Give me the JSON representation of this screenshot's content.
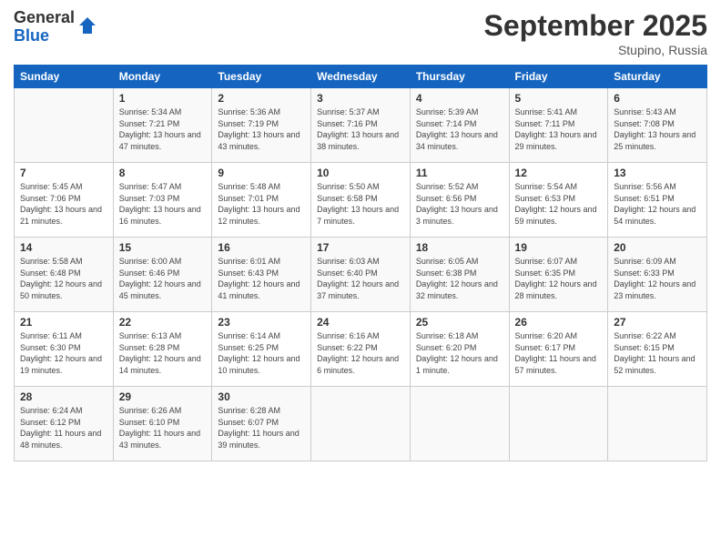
{
  "header": {
    "logo_general": "General",
    "logo_blue": "Blue",
    "month_title": "September 2025",
    "location": "Stupino, Russia"
  },
  "days_of_week": [
    "Sunday",
    "Monday",
    "Tuesday",
    "Wednesday",
    "Thursday",
    "Friday",
    "Saturday"
  ],
  "weeks": [
    [
      {
        "day": "",
        "sunrise": "",
        "sunset": "",
        "daylight": ""
      },
      {
        "day": "1",
        "sunrise": "Sunrise: 5:34 AM",
        "sunset": "Sunset: 7:21 PM",
        "daylight": "Daylight: 13 hours and 47 minutes."
      },
      {
        "day": "2",
        "sunrise": "Sunrise: 5:36 AM",
        "sunset": "Sunset: 7:19 PM",
        "daylight": "Daylight: 13 hours and 43 minutes."
      },
      {
        "day": "3",
        "sunrise": "Sunrise: 5:37 AM",
        "sunset": "Sunset: 7:16 PM",
        "daylight": "Daylight: 13 hours and 38 minutes."
      },
      {
        "day": "4",
        "sunrise": "Sunrise: 5:39 AM",
        "sunset": "Sunset: 7:14 PM",
        "daylight": "Daylight: 13 hours and 34 minutes."
      },
      {
        "day": "5",
        "sunrise": "Sunrise: 5:41 AM",
        "sunset": "Sunset: 7:11 PM",
        "daylight": "Daylight: 13 hours and 29 minutes."
      },
      {
        "day": "6",
        "sunrise": "Sunrise: 5:43 AM",
        "sunset": "Sunset: 7:08 PM",
        "daylight": "Daylight: 13 hours and 25 minutes."
      }
    ],
    [
      {
        "day": "7",
        "sunrise": "Sunrise: 5:45 AM",
        "sunset": "Sunset: 7:06 PM",
        "daylight": "Daylight: 13 hours and 21 minutes."
      },
      {
        "day": "8",
        "sunrise": "Sunrise: 5:47 AM",
        "sunset": "Sunset: 7:03 PM",
        "daylight": "Daylight: 13 hours and 16 minutes."
      },
      {
        "day": "9",
        "sunrise": "Sunrise: 5:48 AM",
        "sunset": "Sunset: 7:01 PM",
        "daylight": "Daylight: 13 hours and 12 minutes."
      },
      {
        "day": "10",
        "sunrise": "Sunrise: 5:50 AM",
        "sunset": "Sunset: 6:58 PM",
        "daylight": "Daylight: 13 hours and 7 minutes."
      },
      {
        "day": "11",
        "sunrise": "Sunrise: 5:52 AM",
        "sunset": "Sunset: 6:56 PM",
        "daylight": "Daylight: 13 hours and 3 minutes."
      },
      {
        "day": "12",
        "sunrise": "Sunrise: 5:54 AM",
        "sunset": "Sunset: 6:53 PM",
        "daylight": "Daylight: 12 hours and 59 minutes."
      },
      {
        "day": "13",
        "sunrise": "Sunrise: 5:56 AM",
        "sunset": "Sunset: 6:51 PM",
        "daylight": "Daylight: 12 hours and 54 minutes."
      }
    ],
    [
      {
        "day": "14",
        "sunrise": "Sunrise: 5:58 AM",
        "sunset": "Sunset: 6:48 PM",
        "daylight": "Daylight: 12 hours and 50 minutes."
      },
      {
        "day": "15",
        "sunrise": "Sunrise: 6:00 AM",
        "sunset": "Sunset: 6:46 PM",
        "daylight": "Daylight: 12 hours and 45 minutes."
      },
      {
        "day": "16",
        "sunrise": "Sunrise: 6:01 AM",
        "sunset": "Sunset: 6:43 PM",
        "daylight": "Daylight: 12 hours and 41 minutes."
      },
      {
        "day": "17",
        "sunrise": "Sunrise: 6:03 AM",
        "sunset": "Sunset: 6:40 PM",
        "daylight": "Daylight: 12 hours and 37 minutes."
      },
      {
        "day": "18",
        "sunrise": "Sunrise: 6:05 AM",
        "sunset": "Sunset: 6:38 PM",
        "daylight": "Daylight: 12 hours and 32 minutes."
      },
      {
        "day": "19",
        "sunrise": "Sunrise: 6:07 AM",
        "sunset": "Sunset: 6:35 PM",
        "daylight": "Daylight: 12 hours and 28 minutes."
      },
      {
        "day": "20",
        "sunrise": "Sunrise: 6:09 AM",
        "sunset": "Sunset: 6:33 PM",
        "daylight": "Daylight: 12 hours and 23 minutes."
      }
    ],
    [
      {
        "day": "21",
        "sunrise": "Sunrise: 6:11 AM",
        "sunset": "Sunset: 6:30 PM",
        "daylight": "Daylight: 12 hours and 19 minutes."
      },
      {
        "day": "22",
        "sunrise": "Sunrise: 6:13 AM",
        "sunset": "Sunset: 6:28 PM",
        "daylight": "Daylight: 12 hours and 14 minutes."
      },
      {
        "day": "23",
        "sunrise": "Sunrise: 6:14 AM",
        "sunset": "Sunset: 6:25 PM",
        "daylight": "Daylight: 12 hours and 10 minutes."
      },
      {
        "day": "24",
        "sunrise": "Sunrise: 6:16 AM",
        "sunset": "Sunset: 6:22 PM",
        "daylight": "Daylight: 12 hours and 6 minutes."
      },
      {
        "day": "25",
        "sunrise": "Sunrise: 6:18 AM",
        "sunset": "Sunset: 6:20 PM",
        "daylight": "Daylight: 12 hours and 1 minute."
      },
      {
        "day": "26",
        "sunrise": "Sunrise: 6:20 AM",
        "sunset": "Sunset: 6:17 PM",
        "daylight": "Daylight: 11 hours and 57 minutes."
      },
      {
        "day": "27",
        "sunrise": "Sunrise: 6:22 AM",
        "sunset": "Sunset: 6:15 PM",
        "daylight": "Daylight: 11 hours and 52 minutes."
      }
    ],
    [
      {
        "day": "28",
        "sunrise": "Sunrise: 6:24 AM",
        "sunset": "Sunset: 6:12 PM",
        "daylight": "Daylight: 11 hours and 48 minutes."
      },
      {
        "day": "29",
        "sunrise": "Sunrise: 6:26 AM",
        "sunset": "Sunset: 6:10 PM",
        "daylight": "Daylight: 11 hours and 43 minutes."
      },
      {
        "day": "30",
        "sunrise": "Sunrise: 6:28 AM",
        "sunset": "Sunset: 6:07 PM",
        "daylight": "Daylight: 11 hours and 39 minutes."
      },
      {
        "day": "",
        "sunrise": "",
        "sunset": "",
        "daylight": ""
      },
      {
        "day": "",
        "sunrise": "",
        "sunset": "",
        "daylight": ""
      },
      {
        "day": "",
        "sunrise": "",
        "sunset": "",
        "daylight": ""
      },
      {
        "day": "",
        "sunrise": "",
        "sunset": "",
        "daylight": ""
      }
    ]
  ]
}
